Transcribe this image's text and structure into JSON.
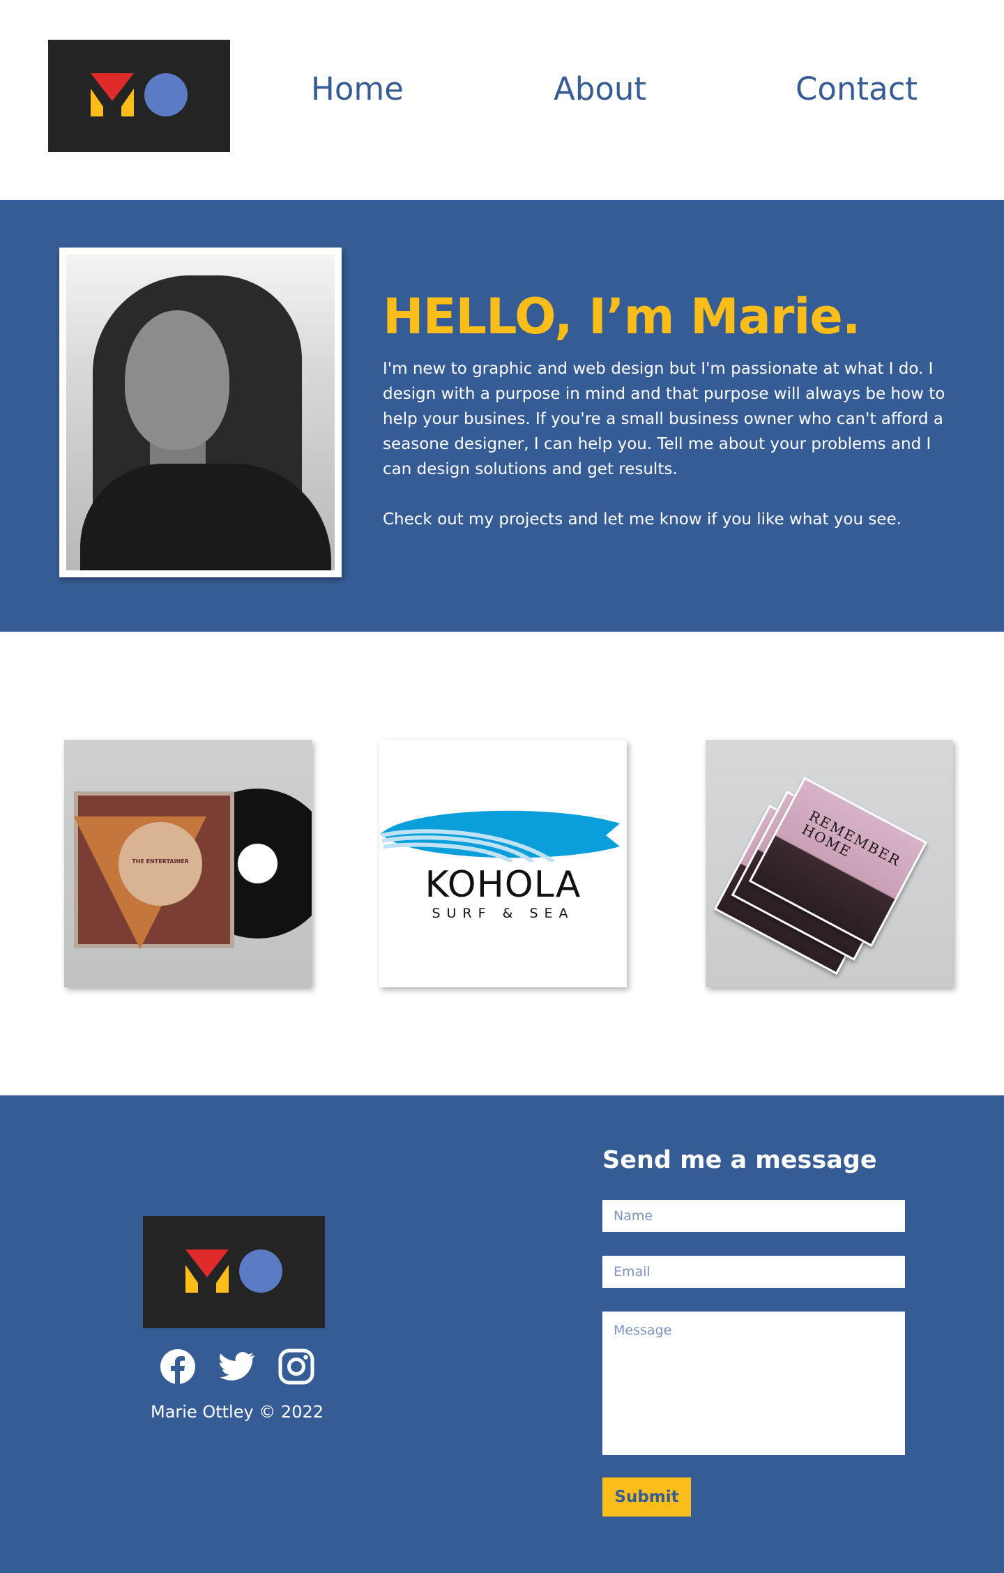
{
  "brand": {
    "logo_name": "MO logo",
    "colors": {
      "blue": "#365c96",
      "yellow": "#fbbd19",
      "red": "#e02b2b",
      "dark": "#242424",
      "light_blue": "#5b7bc4"
    }
  },
  "nav": {
    "items": [
      {
        "label": "Home"
      },
      {
        "label": "About"
      },
      {
        "label": "Contact"
      }
    ]
  },
  "hero": {
    "title": "HELLO, I’m Marie.",
    "paragraphs": [
      "I'm new to graphic and web design but I'm passionate at what I do. I design with a purpose in mind and that purpose will always be how to help your busines. If you're a small business owner who can't afford a seasone designer, I can help you. Tell me about your problems and I can design solutions and get results.",
      "Check out my projects and let me know if you like what you see."
    ],
    "portrait_alt": "portrait photo"
  },
  "projects": {
    "items": [
      {
        "name": "vinyl record sleeve",
        "text": "THE ENTERTAINER"
      },
      {
        "name": "Kohola logo",
        "text": "KOHOLA",
        "subtext": "SURF & SEA"
      },
      {
        "name": "magazine stack",
        "text": "REMEMBER HOME"
      }
    ]
  },
  "footer": {
    "socials": [
      "facebook-icon",
      "twitter-icon",
      "instagram-icon"
    ],
    "copyright": "Marie Ottley © 2022",
    "form": {
      "title": "Send me a message",
      "name_placeholder": "Name",
      "email_placeholder": "Email",
      "message_placeholder": "Message",
      "submit_label": "Submit"
    }
  }
}
